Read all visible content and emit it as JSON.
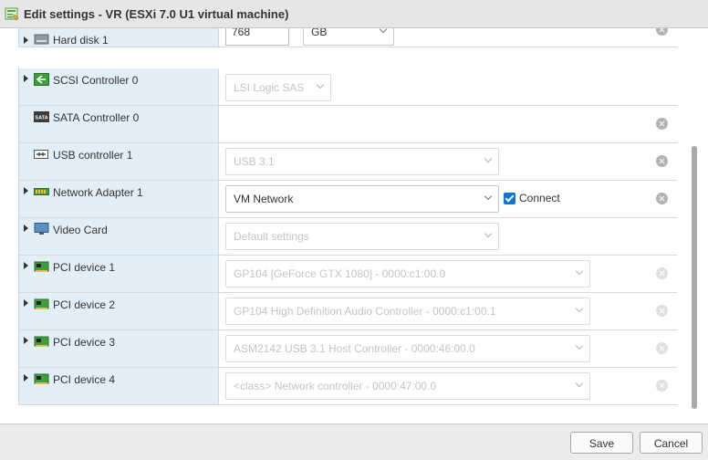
{
  "window": {
    "title": "Edit settings - VR (ESXi 7.0 U1 virtual machine)",
    "icon": "vm-settings-icon"
  },
  "devices": [
    {
      "label": "Hard disk 1",
      "icon": "hard-disk-icon",
      "size_value": "768",
      "size_unit": "GB"
    },
    {
      "label": "SCSI Controller 0",
      "icon": "scsi-controller-icon",
      "value": "LSI Logic SAS"
    },
    {
      "label": "SATA Controller 0",
      "icon": "sata-controller-icon",
      "icon_text": "SATA"
    },
    {
      "label": "USB controller 1",
      "icon": "usb-icon",
      "value": "USB 3.1"
    },
    {
      "label": "Network Adapter 1",
      "icon": "network-adapter-icon",
      "value": "VM Network",
      "connect_label": "Connect",
      "connected": true
    },
    {
      "label": "Video Card",
      "icon": "monitor-icon",
      "value": "Default settings"
    },
    {
      "label": "PCI device 1",
      "icon": "pci-device-icon",
      "value": "GP104 [GeForce GTX 1080] - 0000:c1:00.0"
    },
    {
      "label": "PCI device 2",
      "icon": "pci-device-icon",
      "value": "GP104 High Definition Audio Controller - 0000:c1:00.1"
    },
    {
      "label": "PCI device 3",
      "icon": "pci-device-icon",
      "value": "ASM2142 USB 3.1 Host Controller - 0000:46:00.0"
    },
    {
      "label": "PCI device 4",
      "icon": "pci-device-icon",
      "value": "<class> Network controller - 0000:47:00.0"
    }
  ],
  "footer": {
    "save_label": "Save",
    "cancel_label": "Cancel"
  },
  "colors": {
    "label_column_bg": "#e3eff8",
    "checkbox_accent": "#0e74d1",
    "title_bar_bg": "#e6e6e6"
  }
}
